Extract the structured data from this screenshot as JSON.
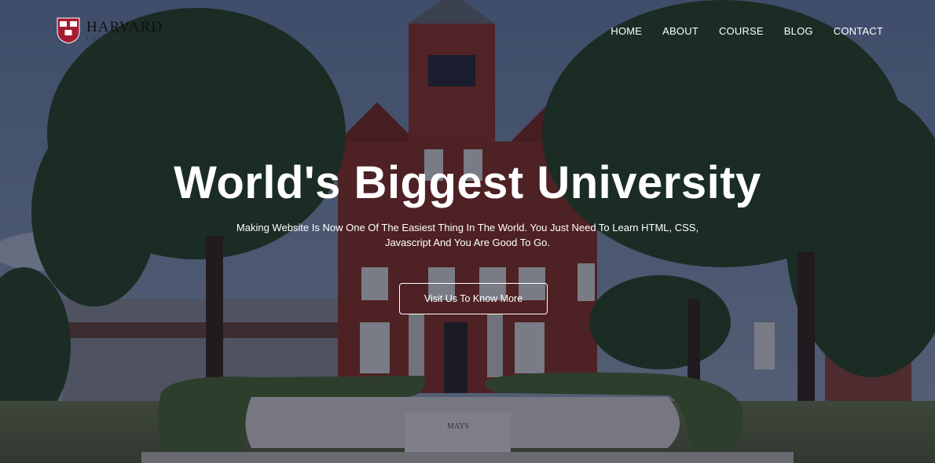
{
  "logo": {
    "name": "HARVARD",
    "subtitle": "UNIVERSITY",
    "shield_text": [
      "VE",
      "RI",
      "TAS"
    ]
  },
  "nav": {
    "items": [
      "HOME",
      "ABOUT",
      "COURSE",
      "BLOG",
      "CONTACT"
    ]
  },
  "hero": {
    "title": "World's Biggest University",
    "subtitle": "Making Website Is Now One Of The Easiest Thing In The World. You Just Need To Learn HTML, CSS, Javascript And You Are Good To Go.",
    "cta_label": "Visit Us To Know More",
    "statue_plaque": "MAYS"
  },
  "colors": {
    "overlay": "#04091e",
    "brick": "#7a2c24",
    "foliage": "#2e4a2a",
    "text": "#ffffff",
    "shield": "#a51c30"
  }
}
